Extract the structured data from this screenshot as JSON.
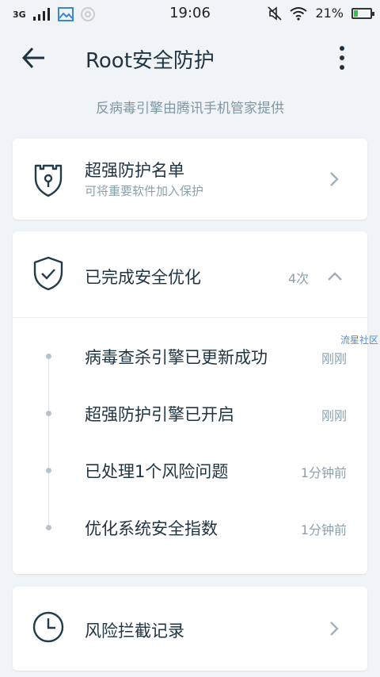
{
  "status_bar": {
    "network": "3G",
    "time": "19:06",
    "battery": "21%",
    "battery_level": 0.21,
    "icons": [
      "signal-icon",
      "image-icon",
      "sync-icon",
      "mute-icon",
      "wifi-icon",
      "battery-icon"
    ]
  },
  "header": {
    "title": "Root安全防护",
    "subtitle": "反病毒引擎由腾讯手机管家提供"
  },
  "protect_list": {
    "title": "超强防护名单",
    "subtitle": "可将重要软件加入保护"
  },
  "optimization": {
    "title": "已完成安全优化",
    "count": "4次",
    "items": [
      {
        "text": "病毒查杀引擎已更新成功",
        "time": "刚刚"
      },
      {
        "text": "超强防护引擎已开启",
        "time": "刚刚"
      },
      {
        "text": "已处理1个风险问题",
        "time": "1分钟前"
      },
      {
        "text": "优化系统安全指数",
        "time": "1分钟前"
      }
    ]
  },
  "risk_records": {
    "title": "风险拦截记录"
  },
  "watermark": "流星社区",
  "colors": {
    "background": "#f1f4f6",
    "text_primary": "#1f3442",
    "text_secondary": "#8aa1ad",
    "battery_green": "#3bc14a"
  }
}
